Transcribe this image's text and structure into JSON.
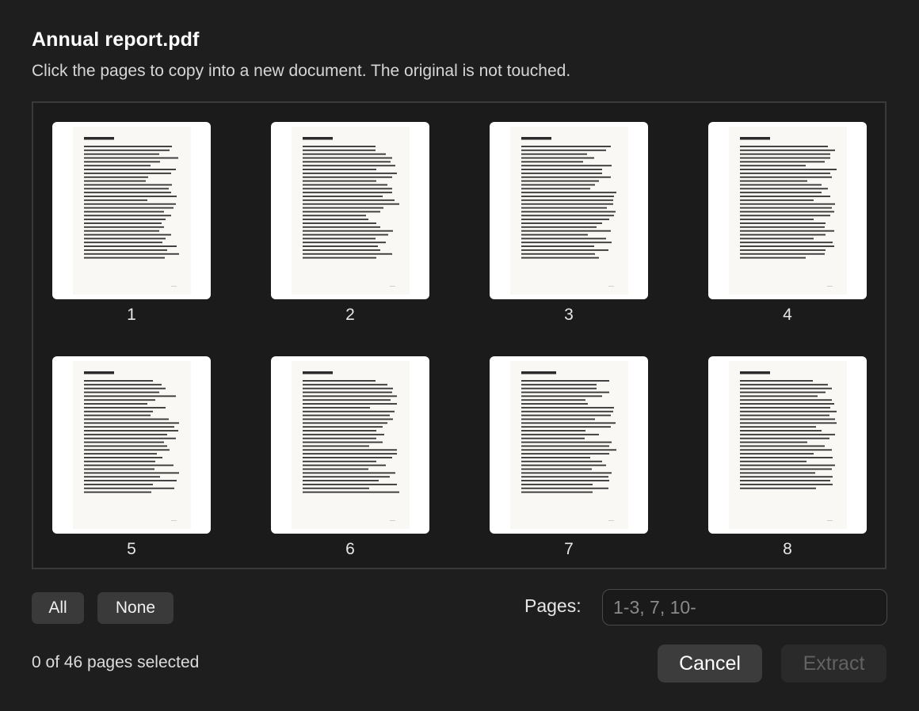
{
  "dialog": {
    "title": "Annual report.pdf",
    "subtitle": "Click the pages to copy into a new document. The original is not touched."
  },
  "pages": [
    {
      "number": "1",
      "selected": false,
      "heading_width": 0.25,
      "lines": [
        0.74,
        0.72,
        0.63,
        0.79,
        0.64,
        0.56,
        0.77,
        0.73,
        0.54,
        0.52,
        0.74,
        0.71,
        0.73,
        0.78,
        0.53,
        0.77,
        0.75,
        0.67,
        0.73,
        0.69,
        0.65,
        0.67,
        0.63,
        0.73,
        0.69,
        0.66,
        0.78,
        0.7,
        0.8,
        0.68
      ]
    },
    {
      "number": "2",
      "selected": false,
      "heading_width": 0.25,
      "lines": [
        0.61,
        0.61,
        0.7,
        0.75,
        0.74,
        0.78,
        0.62,
        0.79,
        0.75,
        0.62,
        0.71,
        0.75,
        0.75,
        0.67,
        0.77,
        0.81,
        0.68,
        0.65,
        0.53,
        0.55,
        0.62,
        0.65,
        0.76,
        0.72,
        0.61,
        0.7,
        0.63,
        0.65,
        0.75,
        0.62
      ]
    },
    {
      "number": "3",
      "selected": false,
      "heading_width": 0.25,
      "lines": [
        0.75,
        0.71,
        0.55,
        0.61,
        0.52,
        0.76,
        0.68,
        0.68,
        0.75,
        0.65,
        0.62,
        0.58,
        0.8,
        0.78,
        0.77,
        0.77,
        0.72,
        0.79,
        0.78,
        0.74,
        0.68,
        0.63,
        0.75,
        0.56,
        0.71,
        0.76,
        0.61,
        0.73,
        0.62,
        0.65
      ]
    },
    {
      "number": "4",
      "selected": false,
      "heading_width": 0.25,
      "lines": [
        0.74,
        0.8,
        0.76,
        0.76,
        0.71,
        0.55,
        0.81,
        0.76,
        0.77,
        0.57,
        0.69,
        0.74,
        0.69,
        0.76,
        0.62,
        0.8,
        0.77,
        0.79,
        0.76,
        0.62,
        0.72,
        0.71,
        0.79,
        0.72,
        0.62,
        0.78,
        0.79,
        0.72,
        0.71,
        0.55
      ]
    },
    {
      "number": "5",
      "selected": false,
      "heading_width": 0.25,
      "lines": [
        0.58,
        0.65,
        0.69,
        0.63,
        0.77,
        0.6,
        0.53,
        0.69,
        0.58,
        0.56,
        0.71,
        0.8,
        0.76,
        0.79,
        0.7,
        0.77,
        0.67,
        0.7,
        0.72,
        0.61,
        0.66,
        0.6,
        0.75,
        0.59,
        0.8,
        0.64,
        0.78,
        0.58,
        0.76,
        0.57
      ]
    },
    {
      "number": "6",
      "selected": false,
      "heading_width": 0.25,
      "lines": [
        0.61,
        0.71,
        0.76,
        0.75,
        0.79,
        0.74,
        0.79,
        0.57,
        0.77,
        0.73,
        0.76,
        0.71,
        0.67,
        0.62,
        0.69,
        0.62,
        0.67,
        0.56,
        0.79,
        0.79,
        0.75,
        0.62,
        0.7,
        0.55,
        0.78,
        0.73,
        0.64,
        0.79,
        0.56,
        0.81
      ]
    },
    {
      "number": "7",
      "selected": false,
      "heading_width": 0.29,
      "lines": [
        0.74,
        0.63,
        0.63,
        0.74,
        0.68,
        0.54,
        0.56,
        0.78,
        0.77,
        0.75,
        0.62,
        0.79,
        0.75,
        0.54,
        0.65,
        0.53,
        0.76,
        0.74,
        0.8,
        0.74,
        0.58,
        0.68,
        0.71,
        0.59,
        0.76,
        0.73,
        0.74,
        0.6,
        0.73,
        0.6
      ]
    },
    {
      "number": "8",
      "selected": false,
      "heading_width": 0.25,
      "lines": [
        0.61,
        0.74,
        0.77,
        0.72,
        0.65,
        0.77,
        0.79,
        0.76,
        0.81,
        0.75,
        0.8,
        0.81,
        0.64,
        0.69,
        0.8,
        0.75,
        0.57,
        0.71,
        0.77,
        0.62,
        0.78,
        0.56,
        0.8,
        0.77,
        0.63,
        0.78,
        0.76,
        0.78,
        0.64
      ]
    }
  ],
  "controls": {
    "all_label": "All",
    "none_label": "None",
    "pages_label": "Pages:",
    "pages_value": "",
    "pages_placeholder": "1-3, 7, 10-",
    "status": "0 of 46 pages selected",
    "cancel_label": "Cancel",
    "extract_label": "Extract",
    "extract_enabled": false
  },
  "colors": {
    "background": "#1e1e1e",
    "thumbnail_card": "#ffffff",
    "sheet": "#f9f8f4",
    "text_line": "#3a3a3a",
    "heading_line": "#2b2b2b"
  }
}
